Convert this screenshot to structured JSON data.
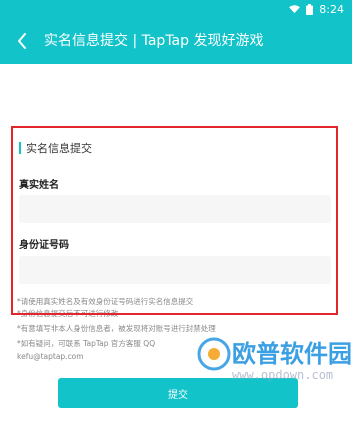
{
  "status_bar": {
    "time": "8:24",
    "icons": [
      "wifi-icon",
      "battery-icon"
    ]
  },
  "app_bar": {
    "back_icon": "chevron-left-icon",
    "title": "实名信息提交 | TapTap 发现好游戏"
  },
  "form": {
    "section_title": "实名信息提交",
    "name_label": "真实姓名",
    "name_value": "",
    "id_label": "身份证号码",
    "id_value": ""
  },
  "notes": [
    "*请使用真实姓名及有效身份证号码进行实名信息提交",
    "*身份信息提交后不可进行修改",
    "*有意填写非本人身份信息者，被发现将对账号进行封禁处理",
    "*如有疑问，可联系 TapTap 官方客服 QQ",
    "kefu@taptap.com"
  ],
  "submit_label": "提交",
  "watermark": {
    "text": "欧普软件园",
    "url": "www.opdown.com"
  },
  "colors": {
    "accent": "#12c3c9",
    "highlight": "#e3262c"
  }
}
